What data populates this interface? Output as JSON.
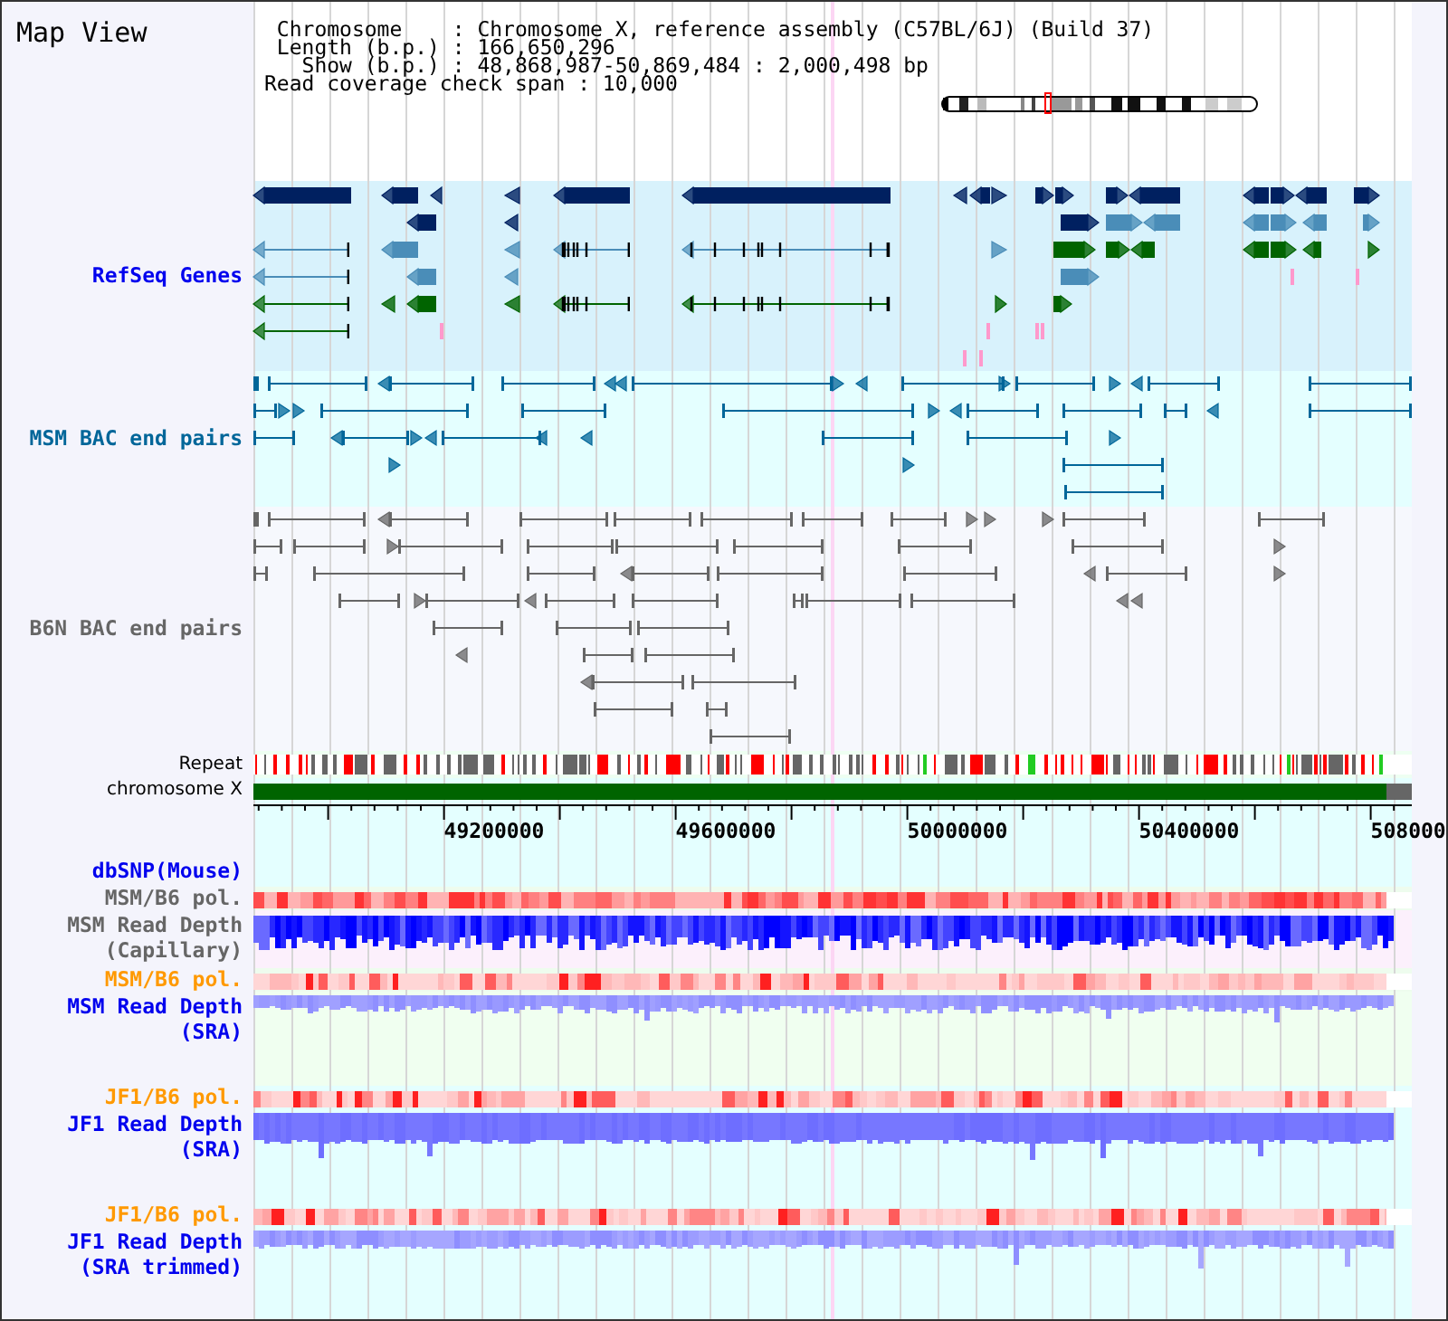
{
  "title": "Map View",
  "info_lines": [
    " Chromosome    : Chromosome X, reference assembly (C57BL/6J) (Build 37)",
    " Length (b.p.) : 166,650,296",
    "   Show (b.p.) : 48,868,987-50,869,484 : 2,000,498 bp",
    "Read coverage check span : 10,000"
  ],
  "tracks": [
    {
      "kind": "genes",
      "label": [
        "RefSeq Genes"
      ],
      "color": "#0000ee"
    },
    {
      "kind": "bac_pairs",
      "label": [
        "MSM BAC end pairs"
      ],
      "color": "#006699"
    },
    {
      "kind": "bac_pairs",
      "label": [
        "B6N BAC end pairs"
      ],
      "color": "#666666"
    },
    {
      "kind": "repeat",
      "label": [
        "Repeat"
      ],
      "color": "#000000"
    },
    {
      "kind": "chromosome",
      "label": [
        "chromosome X"
      ],
      "color": "#000000"
    },
    {
      "kind": "axis",
      "tick_labels": [
        "49200000",
        "49600000",
        "50000000",
        "50400000",
        "508000"
      ]
    },
    {
      "kind": "snp",
      "label": [
        "dbSNP(Mouse)"
      ],
      "color": "#0000ee"
    },
    {
      "kind": "polymorphism",
      "label": [
        "MSM/B6 pol."
      ],
      "color": "#666666"
    },
    {
      "kind": "read_depth",
      "label": [
        "MSM Read Depth",
        "(Capillary)"
      ],
      "color": "#666666"
    },
    {
      "kind": "polymorphism",
      "label": [
        "MSM/B6 pol."
      ],
      "color": "#ff9900"
    },
    {
      "kind": "read_depth",
      "label": [
        "MSM Read Depth",
        "(SRA)"
      ],
      "color": "#0000ee"
    },
    {
      "kind": "polymorphism",
      "label": [
        "JF1/B6 pol."
      ],
      "color": "#ff9900"
    },
    {
      "kind": "read_depth",
      "label": [
        "JF1 Read Depth",
        "(SRA)"
      ],
      "color": "#0000ee"
    },
    {
      "kind": "polymorphism",
      "label": [
        "JF1/B6 pol."
      ],
      "color": "#ff9900"
    },
    {
      "kind": "read_depth",
      "label": [
        "JF1 Read Depth",
        "(SRA trimmed)"
      ],
      "color": "#0000ee"
    }
  ]
}
